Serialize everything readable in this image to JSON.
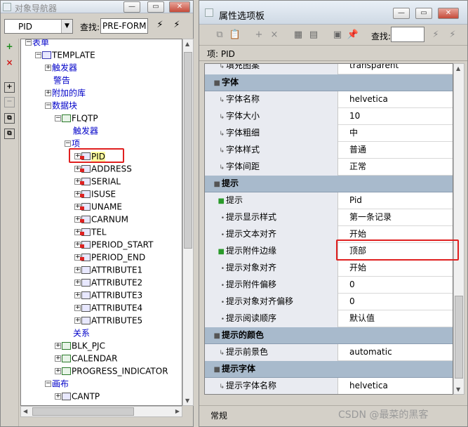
{
  "navigator": {
    "title": "对象导航器",
    "select_value": "PID",
    "find_label": "查找:",
    "find_value": "PRE-FORM",
    "tree": [
      {
        "label": "表单",
        "style": "blue",
        "exp": "−",
        "icon": null,
        "indent": 0
      },
      {
        "label": "TEMPLATE",
        "style": "normal",
        "exp": "−",
        "icon": "tmpl",
        "indent": 1
      },
      {
        "label": "触发器",
        "style": "blue",
        "exp": "+",
        "icon": null,
        "indent": 2
      },
      {
        "label": "警告",
        "style": "blue",
        "exp": null,
        "icon": null,
        "indent": 2
      },
      {
        "label": "附加的库",
        "style": "blue",
        "exp": "+",
        "icon": null,
        "indent": 2
      },
      {
        "label": "数据块",
        "style": "blue",
        "exp": "−",
        "icon": null,
        "indent": 2
      },
      {
        "label": "FLQTP",
        "style": "normal",
        "exp": "−",
        "icon": "blk",
        "indent": 3
      },
      {
        "label": "触发器",
        "style": "blue",
        "exp": null,
        "icon": null,
        "indent": 4
      },
      {
        "label": "项",
        "style": "blue",
        "exp": "−",
        "icon": null,
        "indent": 4
      },
      {
        "label": "PID",
        "style": "hl",
        "exp": "+",
        "icon": "red",
        "indent": 5
      },
      {
        "label": "ADDRESS",
        "style": "normal",
        "exp": "+",
        "icon": "red",
        "indent": 5
      },
      {
        "label": "SERIAL",
        "style": "normal",
        "exp": "+",
        "icon": "red",
        "indent": 5
      },
      {
        "label": "ISUSE",
        "style": "normal",
        "exp": "+",
        "icon": "red",
        "indent": 5
      },
      {
        "label": "UNAME",
        "style": "normal",
        "exp": "+",
        "icon": "red",
        "indent": 5
      },
      {
        "label": "CARNUM",
        "style": "normal",
        "exp": "+",
        "icon": "red",
        "indent": 5
      },
      {
        "label": "TEL",
        "style": "normal",
        "exp": "+",
        "icon": "red",
        "indent": 5
      },
      {
        "label": "PERIOD_START",
        "style": "normal",
        "exp": "+",
        "icon": "red",
        "indent": 5
      },
      {
        "label": "PERIOD_END",
        "style": "normal",
        "exp": "+",
        "icon": "red",
        "indent": 5
      },
      {
        "label": "ATTRIBUTE1",
        "style": "normal",
        "exp": "+",
        "icon": "plain",
        "indent": 5
      },
      {
        "label": "ATTRIBUTE2",
        "style": "normal",
        "exp": "+",
        "icon": "plain",
        "indent": 5
      },
      {
        "label": "ATTRIBUTE3",
        "style": "normal",
        "exp": "+",
        "icon": "plain",
        "indent": 5
      },
      {
        "label": "ATTRIBUTE4",
        "style": "normal",
        "exp": "+",
        "icon": "plain",
        "indent": 5
      },
      {
        "label": "ATTRIBUTE5",
        "style": "normal",
        "exp": "+",
        "icon": "plain",
        "indent": 5
      },
      {
        "label": "关系",
        "style": "blue",
        "exp": null,
        "icon": null,
        "indent": 4
      },
      {
        "label": "BLK_PJC",
        "style": "normal",
        "exp": "+",
        "icon": "blk",
        "indent": 3
      },
      {
        "label": "CALENDAR",
        "style": "normal",
        "exp": "+",
        "icon": "blk",
        "indent": 3
      },
      {
        "label": "PROGRESS_INDICATOR",
        "style": "normal",
        "exp": "+",
        "icon": "blk",
        "indent": 3
      },
      {
        "label": "画布",
        "style": "blue",
        "exp": "−",
        "icon": null,
        "indent": 2
      },
      {
        "label": "CANTP",
        "style": "normal",
        "exp": "+",
        "icon": "plain",
        "indent": 3
      }
    ]
  },
  "palette": {
    "title": "属性选项板",
    "find_label": "查找:",
    "item_label": "项: PID",
    "status": "常规",
    "rows": [
      {
        "type": "prop",
        "marker": "↳",
        "name": "填充图案",
        "value": "transparent"
      },
      {
        "type": "cat",
        "marker": "■",
        "name": "字体",
        "value": ""
      },
      {
        "type": "prop",
        "marker": "↳",
        "name": "字体名称",
        "value": "helvetica"
      },
      {
        "type": "prop",
        "marker": "↳",
        "name": "字体大小",
        "value": "10"
      },
      {
        "type": "prop",
        "marker": "↳",
        "name": "字体粗细",
        "value": "中"
      },
      {
        "type": "prop",
        "marker": "↳",
        "name": "字体样式",
        "value": "普通"
      },
      {
        "type": "prop",
        "marker": "↳",
        "name": "字体间距",
        "value": "正常"
      },
      {
        "type": "cat",
        "marker": "■",
        "name": "提示",
        "value": ""
      },
      {
        "type": "prop",
        "marker": "■",
        "name": "提示",
        "value": "Pid",
        "green": true
      },
      {
        "type": "prop",
        "marker": "•",
        "name": "提示显示样式",
        "value": "第一条记录"
      },
      {
        "type": "prop",
        "marker": "•",
        "name": "提示文本对齐",
        "value": "开始"
      },
      {
        "type": "prop",
        "marker": "■",
        "name": "提示附件边缘",
        "value": "顶部",
        "green": true
      },
      {
        "type": "prop",
        "marker": "•",
        "name": "提示对象对齐",
        "value": "开始"
      },
      {
        "type": "prop",
        "marker": "•",
        "name": "提示附件偏移",
        "value": "0"
      },
      {
        "type": "prop",
        "marker": "•",
        "name": "提示对象对齐偏移",
        "value": "0"
      },
      {
        "type": "prop",
        "marker": "•",
        "name": "提示阅读顺序",
        "value": "默认值"
      },
      {
        "type": "cat",
        "marker": "■",
        "name": "提示的颜色",
        "value": ""
      },
      {
        "type": "prop",
        "marker": "↳",
        "name": "提示前景色",
        "value": "automatic"
      },
      {
        "type": "cat",
        "marker": "■",
        "name": "提示字体",
        "value": ""
      },
      {
        "type": "prop",
        "marker": "↳",
        "name": "提示字体名称",
        "value": "helvetica"
      }
    ]
  },
  "watermark": "CSDN @最菜的黑客",
  "colors": {
    "category_row": "#a8bacc",
    "name_cell": "#e9ebf1",
    "highlight_box": "#e02020",
    "tree_link": "#0000c8"
  }
}
